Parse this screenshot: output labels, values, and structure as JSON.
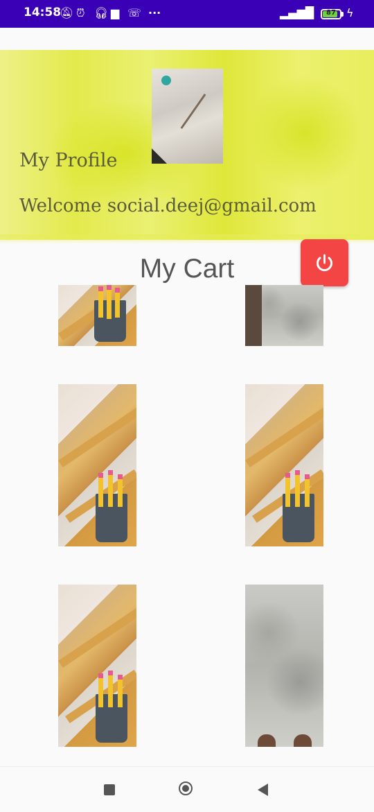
{
  "status_bar": {
    "time": "14:58",
    "icons": [
      "mute-icon",
      "alarm-icon",
      "headset-icon",
      "message-icon",
      "missed-call-icon",
      "more-dots-icon"
    ],
    "more": "···",
    "battery_percent": "87",
    "battery_level": 0.87
  },
  "profile": {
    "label": "My Profile",
    "welcome": "Welcome social.deej@gmail.com"
  },
  "cart": {
    "title": "My Cart",
    "items": [
      {
        "image": "pencil-cup-photo"
      },
      {
        "image": "floor-photo"
      },
      {
        "image": "pencil-cup-photo"
      },
      {
        "image": "pencil-cup-photo"
      },
      {
        "image": "pencil-cup-photo"
      },
      {
        "image": "floor-photo"
      }
    ]
  },
  "actions": {
    "logout_icon": "power-icon",
    "logout_color": "#f44545"
  },
  "nav": {
    "recents_icon": "square-icon",
    "home_icon": "circle-icon",
    "back_icon": "triangle-back-icon"
  },
  "colors": {
    "status_bar": "#3a00b5",
    "header_accent": "#e3ea4c"
  }
}
